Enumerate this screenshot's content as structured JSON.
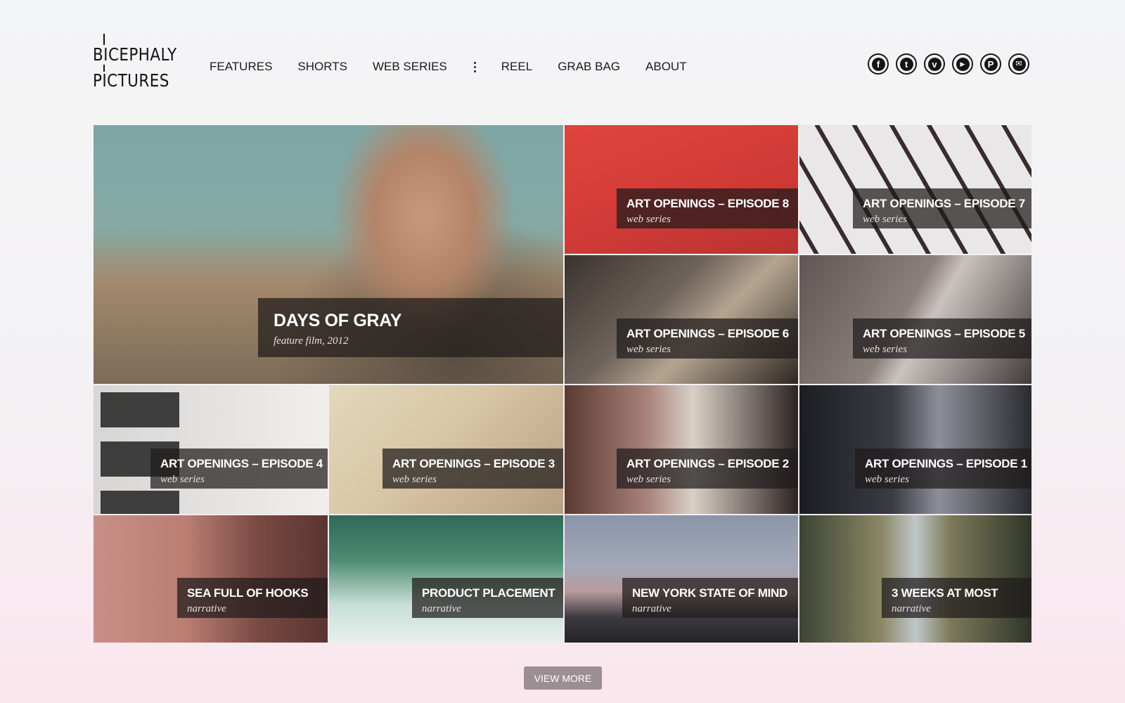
{
  "logo": {
    "line1": "BICEPHALY",
    "line2": "PICTURES"
  },
  "nav": {
    "items_left": [
      "FEATURES",
      "SHORTS",
      "WEB SERIES"
    ],
    "items_right": [
      "REEL",
      "GRAB BAG",
      "ABOUT"
    ]
  },
  "social": [
    {
      "icon": "facebook-icon",
      "glyph": "f"
    },
    {
      "icon": "twitter-icon",
      "glyph": "t"
    },
    {
      "icon": "vimeo-icon",
      "glyph": "v"
    },
    {
      "icon": "youtube-icon",
      "glyph": "▶"
    },
    {
      "icon": "pinterest-icon",
      "glyph": "P"
    },
    {
      "icon": "email-icon",
      "glyph": "✉"
    }
  ],
  "tiles": [
    {
      "title": "DAYS OF GRAY",
      "subtitle": "feature film, 2012"
    },
    {
      "title": "ART OPENINGS – EPISODE 8",
      "subtitle": "web series"
    },
    {
      "title": "ART OPENINGS – EPISODE 7",
      "subtitle": "web series"
    },
    {
      "title": "ART OPENINGS – EPISODE 6",
      "subtitle": "web series"
    },
    {
      "title": "ART OPENINGS – EPISODE 5",
      "subtitle": "web series"
    },
    {
      "title": "ART OPENINGS – EPISODE 4",
      "subtitle": "web series"
    },
    {
      "title": "ART OPENINGS – EPISODE 3",
      "subtitle": "web series"
    },
    {
      "title": "ART OPENINGS – EPISODE 2",
      "subtitle": "web series"
    },
    {
      "title": "ART OPENINGS – EPISODE 1",
      "subtitle": "web series"
    },
    {
      "title": "SEA FULL OF HOOKS",
      "subtitle": "narrative"
    },
    {
      "title": "PRODUCT PLACEMENT",
      "subtitle": "narrative"
    },
    {
      "title": "NEW YORK STATE OF MIND",
      "subtitle": "narrative"
    },
    {
      "title": "3 WEEKS AT MOST",
      "subtitle": "narrative"
    }
  ],
  "view_more_label": "VIEW MORE",
  "colors": {
    "caption_bg": "#1e1a1a",
    "button_bg": "#9c8f93",
    "text": "#111111"
  }
}
